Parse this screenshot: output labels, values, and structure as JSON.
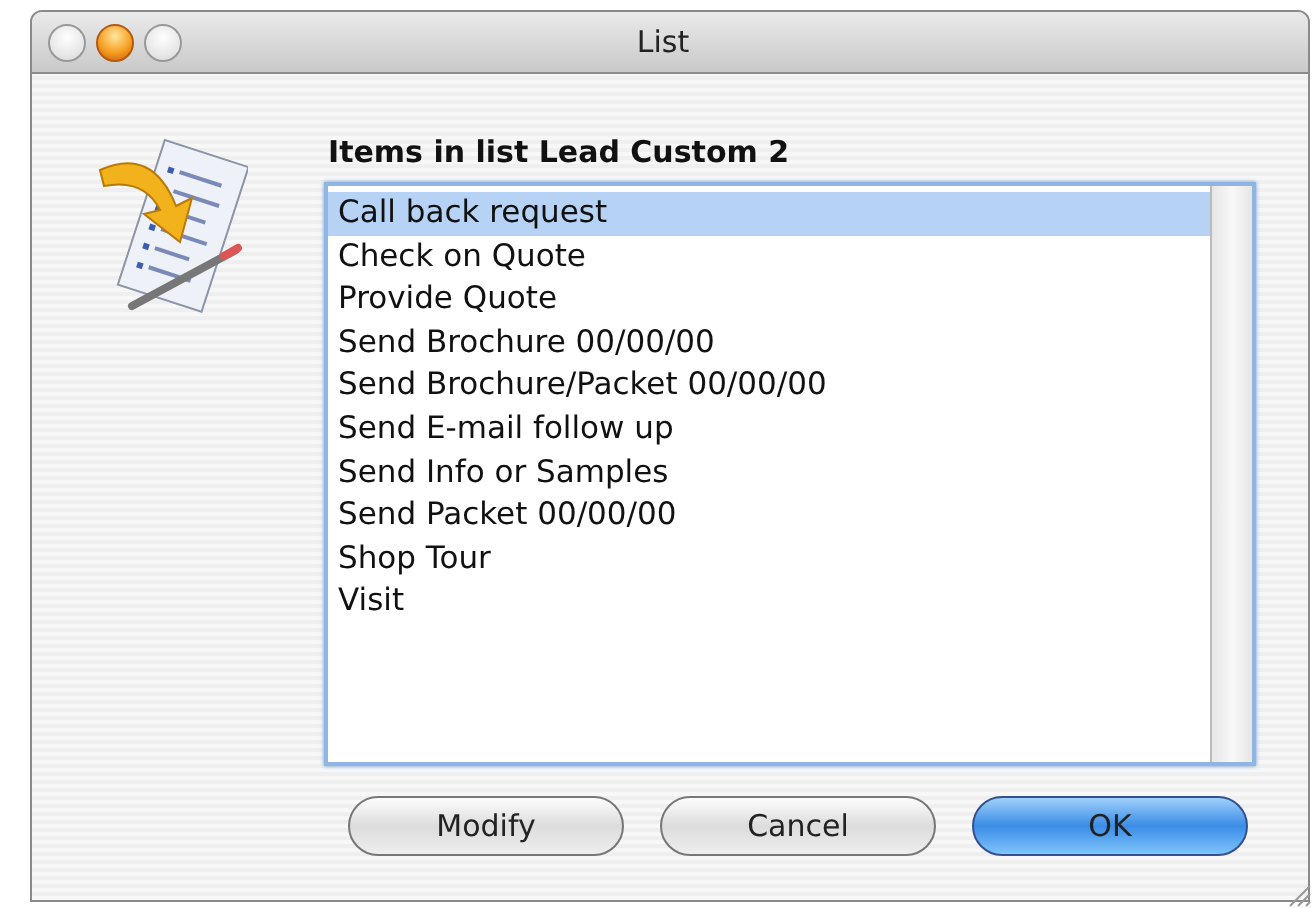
{
  "window": {
    "title": "List"
  },
  "heading": "Items in list Lead Custom 2",
  "items": [
    {
      "label": "Call back request",
      "selected": true
    },
    {
      "label": "Check on Quote",
      "selected": false
    },
    {
      "label": "Provide Quote",
      "selected": false
    },
    {
      "label": "Send Brochure 00/00/00",
      "selected": false
    },
    {
      "label": "Send Brochure/Packet 00/00/00",
      "selected": false
    },
    {
      "label": "Send E-mail follow up",
      "selected": false
    },
    {
      "label": "Send Info or Samples",
      "selected": false
    },
    {
      "label": "Send Packet 00/00/00",
      "selected": false
    },
    {
      "label": "Shop Tour",
      "selected": false
    },
    {
      "label": "Visit",
      "selected": false
    }
  ],
  "buttons": [
    {
      "label": "Modify",
      "default": false
    },
    {
      "label": "Cancel",
      "default": false
    },
    {
      "label": "OK",
      "default": true
    }
  ]
}
